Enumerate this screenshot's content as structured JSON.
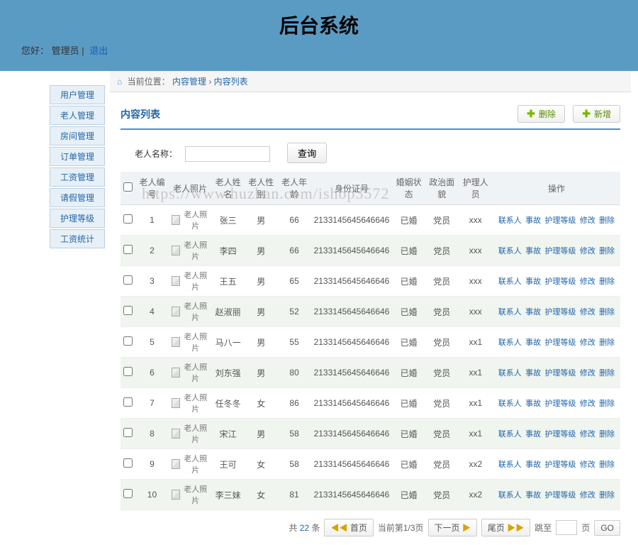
{
  "header": {
    "title": "后台系统"
  },
  "greeting": {
    "prefix": "您好：",
    "user": "管理员",
    "sep": "|",
    "logout": "退出"
  },
  "sidebar": {
    "items": [
      "用户管理",
      "老人管理",
      "房间管理",
      "订单管理",
      "工资管理",
      "请假管理",
      "护理等级",
      "工资统计"
    ]
  },
  "breadcrumb": {
    "label": "当前位置：",
    "p1": "内容管理",
    "p2": "内容列表"
  },
  "panel": {
    "title": "内容列表",
    "delete_label": "删除",
    "add_label": "新增"
  },
  "search": {
    "label": "老人名称：",
    "value": "",
    "button": "查询"
  },
  "table": {
    "headers": [
      "",
      "老人编号",
      "老人照片",
      "老人姓名",
      "老人性别",
      "老人年龄",
      "身份证号",
      "婚姻状态",
      "政治面貌",
      "护理人员",
      "操作"
    ],
    "photo_text": "老人照片",
    "rows": [
      {
        "id": "1",
        "name": "张三",
        "gender": "男",
        "age": "66",
        "idnum": "2133145645646646",
        "marital": "已婚",
        "party": "党员",
        "nurse": "xxx"
      },
      {
        "id": "2",
        "name": "李四",
        "gender": "男",
        "age": "66",
        "idnum": "2133145645646646",
        "marital": "已婚",
        "party": "党员",
        "nurse": "xxx"
      },
      {
        "id": "3",
        "name": "王五",
        "gender": "男",
        "age": "65",
        "idnum": "2133145645646646",
        "marital": "已婚",
        "party": "党员",
        "nurse": "xxx"
      },
      {
        "id": "4",
        "name": "赵淑丽",
        "gender": "男",
        "age": "52",
        "idnum": "2133145645646646",
        "marital": "已婚",
        "party": "党员",
        "nurse": "xxx"
      },
      {
        "id": "5",
        "name": "马八一",
        "gender": "男",
        "age": "55",
        "idnum": "2133145645646646",
        "marital": "已婚",
        "party": "党员",
        "nurse": "xx1"
      },
      {
        "id": "6",
        "name": "刘东强",
        "gender": "男",
        "age": "80",
        "idnum": "2133145645646646",
        "marital": "已婚",
        "party": "党员",
        "nurse": "xx1"
      },
      {
        "id": "7",
        "name": "任冬冬",
        "gender": "女",
        "age": "86",
        "idnum": "2133145645646646",
        "marital": "已婚",
        "party": "党员",
        "nurse": "xx1"
      },
      {
        "id": "8",
        "name": "宋江",
        "gender": "男",
        "age": "58",
        "idnum": "2133145645646646",
        "marital": "已婚",
        "party": "党员",
        "nurse": "xx1"
      },
      {
        "id": "9",
        "name": "王可",
        "gender": "女",
        "age": "58",
        "idnum": "2133145645646646",
        "marital": "已婚",
        "party": "党员",
        "nurse": "xx2"
      },
      {
        "id": "10",
        "name": "李三妹",
        "gender": "女",
        "age": "81",
        "idnum": "2133145645646646",
        "marital": "已婚",
        "party": "党员",
        "nurse": "xx2"
      }
    ]
  },
  "ops": {
    "contact": "联系人",
    "accident": "事故",
    "level": "护理等级",
    "edit": "修改",
    "del": "删除"
  },
  "pagination": {
    "total_prefix": "共 ",
    "total": "22",
    "total_suffix": " 条",
    "first": "首页",
    "current": "当前第1/3页",
    "next": "下一页",
    "last": "尾页",
    "jump_label": "跳至",
    "page_suffix": "页",
    "go": "GO"
  },
  "watermark": "https://www.huzhan.com/ishop3572"
}
